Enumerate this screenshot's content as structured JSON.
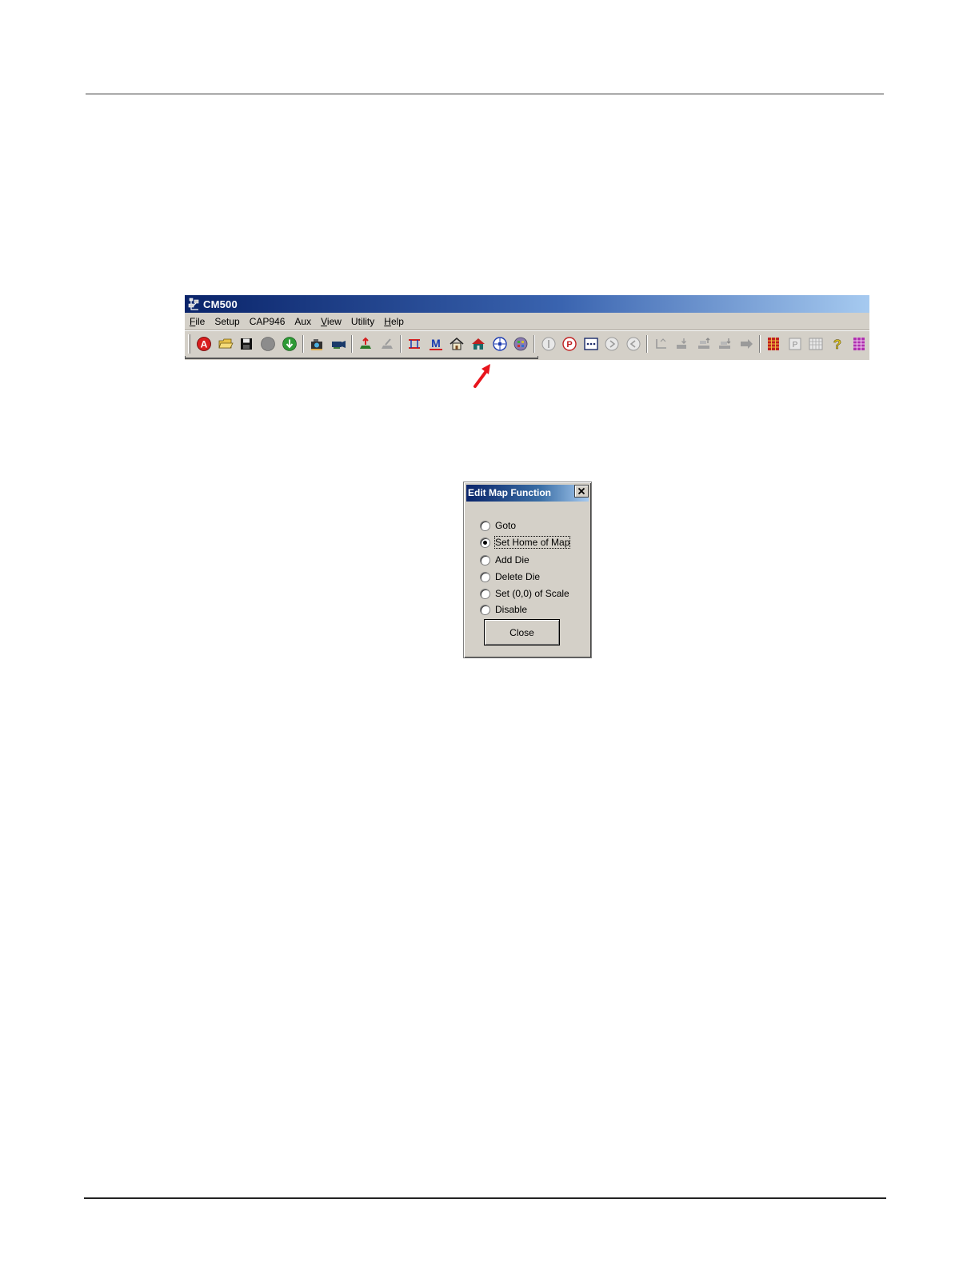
{
  "app_window": {
    "title": "CM500",
    "menu": [
      {
        "pre": "",
        "key": "F",
        "post": "ile"
      },
      {
        "pre": "Setup",
        "key": "",
        "post": ""
      },
      {
        "pre": "CAP946",
        "key": "",
        "post": ""
      },
      {
        "pre": "Aux",
        "key": "",
        "post": ""
      },
      {
        "pre": "",
        "key": "V",
        "post": "iew"
      },
      {
        "pre": "Utility",
        "key": "",
        "post": ""
      },
      {
        "pre": "",
        "key": "H",
        "post": "elp"
      }
    ]
  },
  "toolbar_icons": [
    "auto-icon",
    "open-folder-icon",
    "save-icon",
    "stop-icon",
    "download-icon",
    "camera-icon",
    "projector-icon",
    "load-wafer-icon",
    "unload-wafer-icon",
    "align-icon",
    "map-icon",
    "home-icon",
    "set-home-icon",
    "edit-map-icon",
    "wafer-map-icon",
    "step-one-icon",
    "probe-icon",
    "die-grid-icon",
    "next-die-icon",
    "prev-die-icon",
    "chuck-up-icon",
    "chuck-down-icon",
    "z-up-icon",
    "z-down-icon",
    "move-right-icon",
    "bin-table-icon",
    "pattern-icon",
    "grid-table-icon",
    "help-icon",
    "bin-chart-icon"
  ],
  "dialog": {
    "title": "Edit Map Function",
    "options": [
      {
        "label": "Goto",
        "checked": false
      },
      {
        "label": "Set Home of Map",
        "checked": true
      },
      {
        "label": "Add Die",
        "checked": false
      },
      {
        "label": "Delete Die",
        "checked": false
      },
      {
        "label": "Set (0,0) of Scale",
        "checked": false
      },
      {
        "label": "Disable",
        "checked": false
      }
    ],
    "close_label": "Close"
  },
  "colors": {
    "titlebar_start": "#0a246a",
    "titlebar_end": "#a6caf0",
    "window_face": "#d4d0c8",
    "annotation_arrow": "#e8141c"
  }
}
